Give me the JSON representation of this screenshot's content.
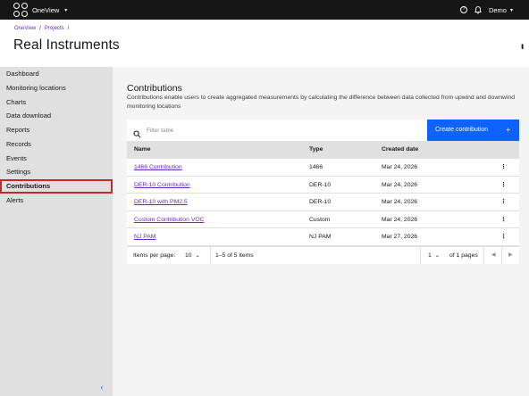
{
  "topbar": {
    "app_name": "OneView",
    "help_label": "?",
    "user_name": "Demo"
  },
  "breadcrumb": {
    "items": [
      "OneView",
      "Projects"
    ]
  },
  "page": {
    "title": "Real Instruments"
  },
  "sidebar": {
    "items": [
      {
        "label": "Dashboard"
      },
      {
        "label": "Monitoring locations"
      },
      {
        "label": "Charts"
      },
      {
        "label": "Data download"
      },
      {
        "label": "Reports"
      },
      {
        "label": "Records"
      },
      {
        "label": "Events"
      },
      {
        "label": "Settings"
      },
      {
        "label": "Contributions",
        "active": true
      },
      {
        "label": "Alerts"
      }
    ],
    "collapse_icon": "chevron-left-icon"
  },
  "section": {
    "title": "Contributions",
    "description": "Contributions enable users to create aggregated measurements by calculating the difference between data collected from upwind and downwind monitoring locations"
  },
  "toolbar": {
    "search_placeholder": "Filter table",
    "create_label": "Create contribution",
    "create_icon": "+"
  },
  "table": {
    "columns": [
      "Name",
      "Type",
      "Created date"
    ],
    "rows": [
      {
        "name": "1466 Contribution",
        "type": "1466",
        "created": "Mar 24, 2026"
      },
      {
        "name": "DER-10 Contribution",
        "type": "DER-10",
        "created": "Mar 24, 2026"
      },
      {
        "name": "DER-10 with PM2.5",
        "type": "DER-10",
        "created": "Mar 24, 2026"
      },
      {
        "name": "Custom Contribution VOC",
        "type": "Custom",
        "created": "Mar 24, 2026"
      },
      {
        "name": "NJ PAM",
        "type": "NJ PAM",
        "created": "Mar 27, 2026"
      }
    ]
  },
  "pagination": {
    "items_per_page_label": "Items per page:",
    "items_per_page": "10",
    "range_text": "1–5 of 5 items",
    "page": "1",
    "of_pages": "of 1 pages"
  },
  "colors": {
    "accent": "#0f62fe",
    "link": "#6929c4",
    "active_outline": "#c62828",
    "topbar": "#161616"
  }
}
